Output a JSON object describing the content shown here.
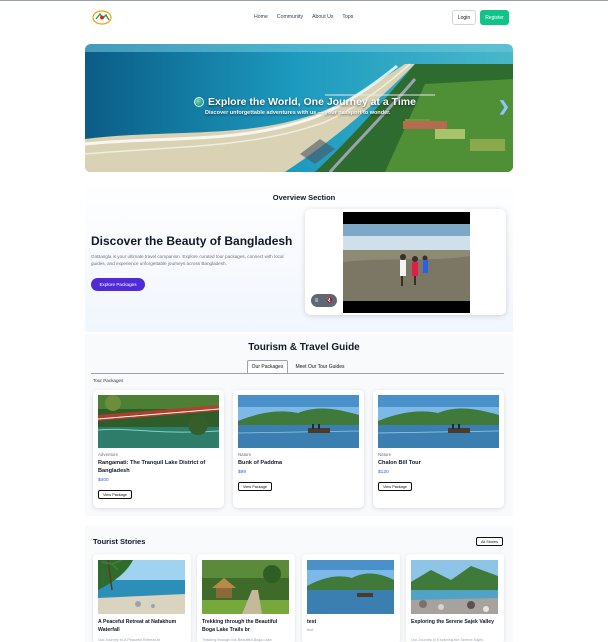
{
  "nav": {
    "links": [
      "Home",
      "Community",
      "About Us",
      "Tops"
    ],
    "login_label": "Login",
    "register_label": "Register",
    "accent_color": "#10c38a"
  },
  "hero": {
    "title": "Explore the World, One Journey at a Time",
    "subtitle": "Discover unforgettable adventures with us — your passport to wonder.",
    "next_arrow": "❯"
  },
  "overview": {
    "section_title": "Overview Section",
    "heading": "Discover the Beauty of Bangladesh",
    "description": "GoBangla is your ultimate travel companion. Explore curated tour packages, connect with local guides, and experience unforgettable journeys across Bangladesh.",
    "button_label": "Explore Packages",
    "button_color": "#4f2bd8"
  },
  "guide": {
    "title": "Tourism & Travel Guide",
    "tabs": [
      "Our Packages",
      "Meet Our Tour Guides"
    ],
    "list_label": "Tour Packages",
    "packages": [
      {
        "category": "Adventure",
        "name": "Rangamati: The Tranquil Lake District of Bangladesh",
        "price": "$400",
        "button": "View Package"
      },
      {
        "category": "Nature",
        "name": "Bunk of Paddma",
        "price": "$99",
        "button": "View Package"
      },
      {
        "category": "Nature",
        "name": "Chalon Bill Tour",
        "price": "$120",
        "button": "View Package"
      }
    ]
  },
  "stories": {
    "title": "Tourist Stories",
    "all_button": "All Stories",
    "items": [
      {
        "title": "A Peaceful Retreat at Nafakhum Waterfall",
        "desc": "Our Journey to A Peaceful Retreat at"
      },
      {
        "title": "Trekking through the Beautiful Boga Lake Trails br",
        "desc": "Trekking through the Beautiful Boga Lake"
      },
      {
        "title": "test",
        "desc": "test"
      },
      {
        "title": "Exploring the Serene Sajek Valley",
        "desc": "Our Journey to Exploring the Serene Sajek"
      }
    ]
  }
}
